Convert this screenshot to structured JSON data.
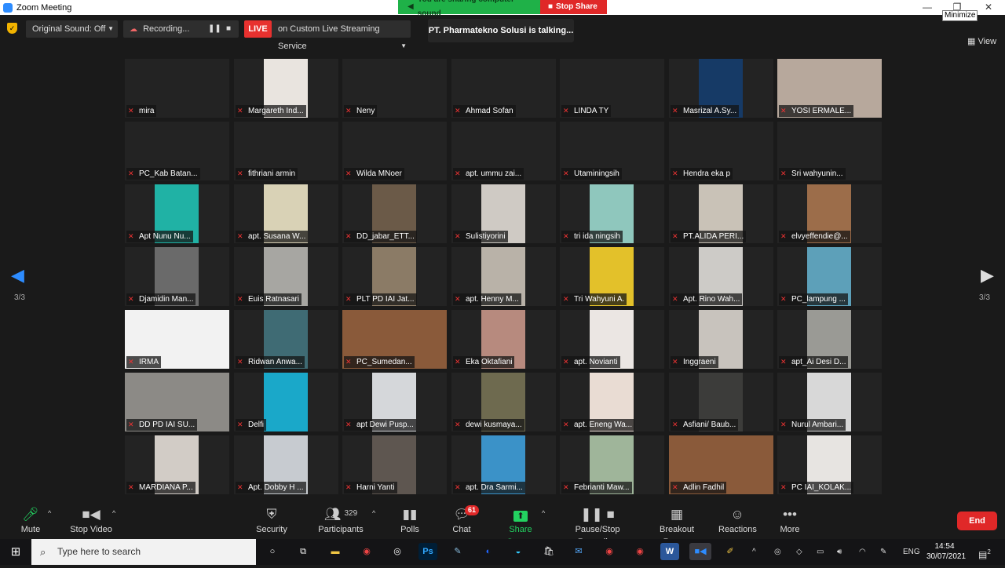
{
  "window": {
    "title": "Zoom Meeting",
    "minimize_tooltip": "Minimize"
  },
  "share_banner": {
    "sound_text": "You are sharing computer sound",
    "stop_label": "Stop Share"
  },
  "topbar": {
    "original_sound": "Original Sound: Off",
    "recording": "Recording...",
    "live_label": "LIVE",
    "live_service": "on Custom Live Streaming Service",
    "talking": "PT. Pharmatekno Solusi is talking...",
    "view_label": "View"
  },
  "pagination": {
    "left_label": "3/3",
    "right_label": "3/3"
  },
  "participants": [
    {
      "name": "mira",
      "video": false
    },
    {
      "name": "Margareth Ind...",
      "video": true,
      "bg": "#e9e4df"
    },
    {
      "name": "Neny",
      "video": false
    },
    {
      "name": "Ahmad Sofan",
      "video": false
    },
    {
      "name": "LINDA TY",
      "video": false
    },
    {
      "name": "Masrizal A.Sy...",
      "video": true,
      "bg": "#163a66"
    },
    {
      "name": "YOSI ERMALE...",
      "video": true,
      "bg": "#b7a89c",
      "full": true
    },
    {
      "name": "PC_Kab Batan...",
      "video": false
    },
    {
      "name": "fithriani armin",
      "video": false
    },
    {
      "name": "Wilda MNoer",
      "video": false
    },
    {
      "name": "apt. ummu zai...",
      "video": false
    },
    {
      "name": "Utaminingsih",
      "video": false
    },
    {
      "name": "Hendra eka p",
      "video": false
    },
    {
      "name": "Sri wahyunin...",
      "video": false
    },
    {
      "name": "Apt Nunu Nu...",
      "video": true,
      "bg": "#20b2a5"
    },
    {
      "name": "apt. Susana W...",
      "video": true,
      "bg": "#d9d2b6"
    },
    {
      "name": "DD_jabar_ETT...",
      "video": true,
      "bg": "#6b5a48"
    },
    {
      "name": "Sulistiyorini",
      "video": true,
      "bg": "#cfcac4"
    },
    {
      "name": "tri ida ningsih",
      "video": true,
      "bg": "#8fc7bd"
    },
    {
      "name": "PT.ALIDA PERI...",
      "video": true,
      "bg": "#c9c2b7"
    },
    {
      "name": "elvyeffendie@...",
      "video": true,
      "bg": "#9c6d4a"
    },
    {
      "name": "Djamidin Man...",
      "video": true,
      "bg": "#6a6a6a"
    },
    {
      "name": "Euis Ratnasari",
      "video": true,
      "bg": "#a7a6a2"
    },
    {
      "name": "PLT PD IAI Jat...",
      "video": true,
      "bg": "#8b7b66"
    },
    {
      "name": "apt. Henny M...",
      "video": true,
      "bg": "#b9b2a8"
    },
    {
      "name": "Tri Wahyuni A.",
      "video": true,
      "bg": "#e3c12a"
    },
    {
      "name": "Apt. Rino Wah...",
      "video": true,
      "bg": "#cdcbc7"
    },
    {
      "name": "PC_lampung ...",
      "video": true,
      "bg": "#5da0b9"
    },
    {
      "name": "IRMA",
      "video": true,
      "bg": "#f2f2f2",
      "full": true
    },
    {
      "name": "Ridwan Anwa...",
      "video": true,
      "bg": "#3f6b74"
    },
    {
      "name": "PC_Sumedan...",
      "video": true,
      "bg": "#8a5a3a",
      "full": true
    },
    {
      "name": "Eka Oktafiani",
      "video": true,
      "bg": "#b78a7e"
    },
    {
      "name": "apt. Novianti",
      "video": true,
      "bg": "#ebe6e3"
    },
    {
      "name": "Inggraeni",
      "video": true,
      "bg": "#c8c3bd"
    },
    {
      "name": "apt_Ai Desi D...",
      "video": true,
      "bg": "#9a9a95"
    },
    {
      "name": "DD PD IAI SU...",
      "video": true,
      "bg": "#8c8a86",
      "full": true
    },
    {
      "name": "Delfi",
      "video": true,
      "bg": "#1aa8c9"
    },
    {
      "name": "apt Dewi Pusp...",
      "video": true,
      "bg": "#d5d7da"
    },
    {
      "name": "dewi kusmaya...",
      "video": true,
      "bg": "#6e6a4f"
    },
    {
      "name": "apt. Eneng Wa...",
      "video": true,
      "bg": "#e9dcd3"
    },
    {
      "name": "Asfiani/ Baub...",
      "video": true,
      "bg": "#3c3c3a"
    },
    {
      "name": "Nurul Ambari...",
      "video": true,
      "bg": "#d8d8d8"
    },
    {
      "name": "MARDIANA P...",
      "video": true,
      "bg": "#d2ccc6"
    },
    {
      "name": "Apt. Dobby H ...",
      "video": true,
      "bg": "#c7cbd0"
    },
    {
      "name": "Harni Yanti",
      "video": true,
      "bg": "#5e5650"
    },
    {
      "name": "apt. Dra Sarmi...",
      "video": true,
      "bg": "#3b92c8"
    },
    {
      "name": "Febrianti Maw...",
      "video": true,
      "bg": "#9fb59a"
    },
    {
      "name": "Adlin Fadhil",
      "video": true,
      "bg": "#8a5a3a",
      "full": true
    },
    {
      "name": "PC IAI_KOLAK...",
      "video": true,
      "bg": "#e7e4e1"
    }
  ],
  "toolbar": {
    "mute": "Mute",
    "stop_video": "Stop Video",
    "security": "Security",
    "participants": "Participants",
    "participants_count": "329",
    "polls": "Polls",
    "chat": "Chat",
    "chat_badge": "61",
    "share_screen": "Share Screen",
    "pause_recording": "Pause/Stop Recording",
    "breakout_rooms": "Breakout Rooms",
    "reactions": "Reactions",
    "more": "More",
    "end": "End"
  },
  "taskbar": {
    "search_placeholder": "Type here to search",
    "language": "ENG",
    "time": "14:54",
    "date": "30/07/2021",
    "notification_count": "2"
  },
  "colors": {
    "accent": "#2d8cff",
    "live": "#e8312f",
    "share_green": "#23d160",
    "end_red": "#e02828"
  }
}
